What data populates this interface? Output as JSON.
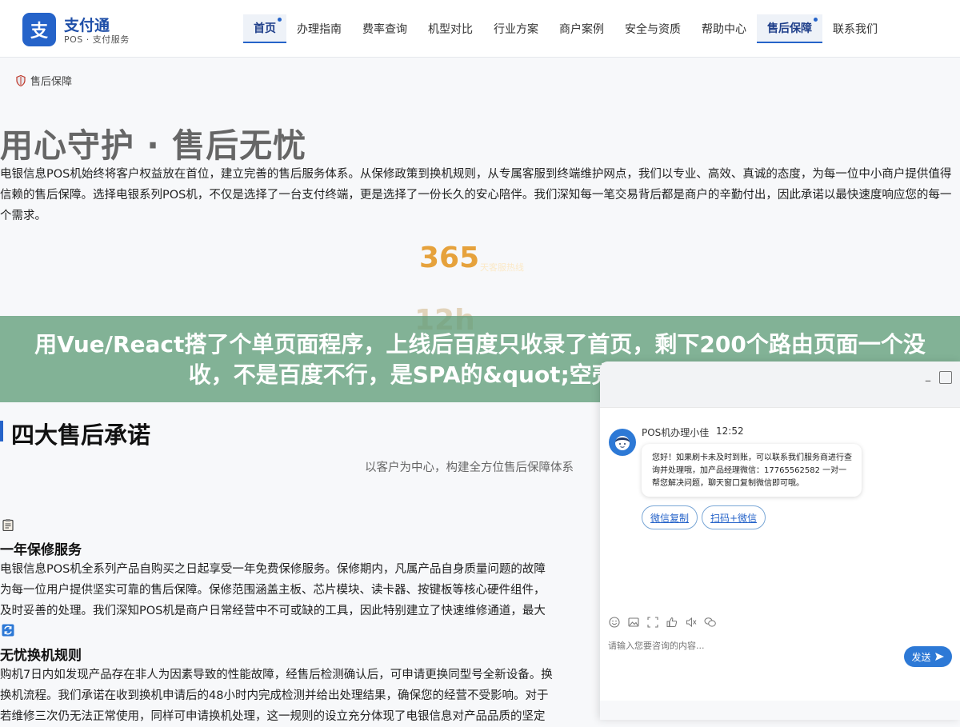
{
  "brand": {
    "logo_char": "支",
    "name": "支付通",
    "subtitle": "POS · 支付服务"
  },
  "nav": [
    {
      "label": "首页",
      "active": true
    },
    {
      "label": "办理指南",
      "active": false
    },
    {
      "label": "费率查询",
      "active": false
    },
    {
      "label": "机型对比",
      "active": false
    },
    {
      "label": "行业方案",
      "active": false
    },
    {
      "label": "商户案例",
      "active": false
    },
    {
      "label": "安全与资质",
      "active": false
    },
    {
      "label": "帮助中心",
      "active": false
    },
    {
      "label": "售后保障",
      "active": true
    },
    {
      "label": "联系我们",
      "active": false
    }
  ],
  "breadcrumb": {
    "label": "售后保障",
    "icon": "shield-icon"
  },
  "hero": {
    "title": "用心守护 · 售后无忧",
    "description": "电银信息POS机始终将客户权益放在首位，建立完善的售后服务体系。从保修政策到换机规则，从专属客服到终端维护网点，我们以专业、高效、真诚的态度，为每一位中小商户提供值得信赖的售后保障。选择电银系列POS机，不仅是选择了一台支付终端，更是选择了一份长久的安心陪伴。我们深知每一笔交易背后都是商户的辛勤付出，因此承诺以最快速度响应您的每一个需求。"
  },
  "stats": [
    {
      "value": "365",
      "label": "天客服热线"
    },
    {
      "value": "12h"
    }
  ],
  "banner": {
    "text": "用Vue/React搭了个单页面程序，上线后百度只收录了首页，剩下200个路由页面一个没收，不是百度不行，是SPA的&quot;空壳HTML&quot;"
  },
  "section": {
    "title": "四大售后承诺",
    "subtitle": "以客户为中心，构建全方位售后保障体系",
    "items": [
      {
        "icon": "clipboard-icon",
        "title": "一年保修服务",
        "lines": [
          "电银信息POS机全系列产品自购买之日起享受一年免费保修服务。保修期内，凡属产品自身质量问题的故障",
          "为每一位用户提供坚实可靠的售后保障。保修范围涵盖主板、芯片模块、读卡器、按键板等核心硬件组件，",
          "及时妥善的处理。我们深知POS机是商户日常经营中不可或缺的工具，因此特别建立了快速维修通道，最大"
        ]
      },
      {
        "icon": "swap-icon",
        "title": "无忧换机规则",
        "lines": [
          "购机7日内如发现产品存在非人为因素导致的性能故障，经售后检测确认后，可申请更换同型号全新设备。换",
          "换机流程。我们承诺在收到换机申请后的48小时内完成检测并给出处理结果，确保您的经营不受影响。对于",
          "若维修三次仍无法正常使用，同样可申请换机处理，这一规则的设立充分体现了电银信息对产品品质的坚定"
        ]
      }
    ]
  },
  "chat": {
    "agent_name": "POS机办理小佳",
    "time": "12:52",
    "message": "您好！如果刷卡未及时到账，可以联系我们服务商进行查询并处理哦，加产品经理微信：17765562582 一对一帮您解决问题，聊天窗口复制微信即可哦。",
    "chips": [
      "微信复制",
      "扫码+微信"
    ],
    "input_placeholder": "请输入您要咨询的内容...",
    "send_label": "发送",
    "minimize": "–",
    "tools": [
      "emoji-icon",
      "image-icon",
      "screenshot-icon",
      "like-icon",
      "sound-icon",
      "chat-icon"
    ]
  },
  "colors": {
    "accent": "#2563c9",
    "stat_gold": "#e6a23c",
    "banner_green": "#629e7a"
  }
}
